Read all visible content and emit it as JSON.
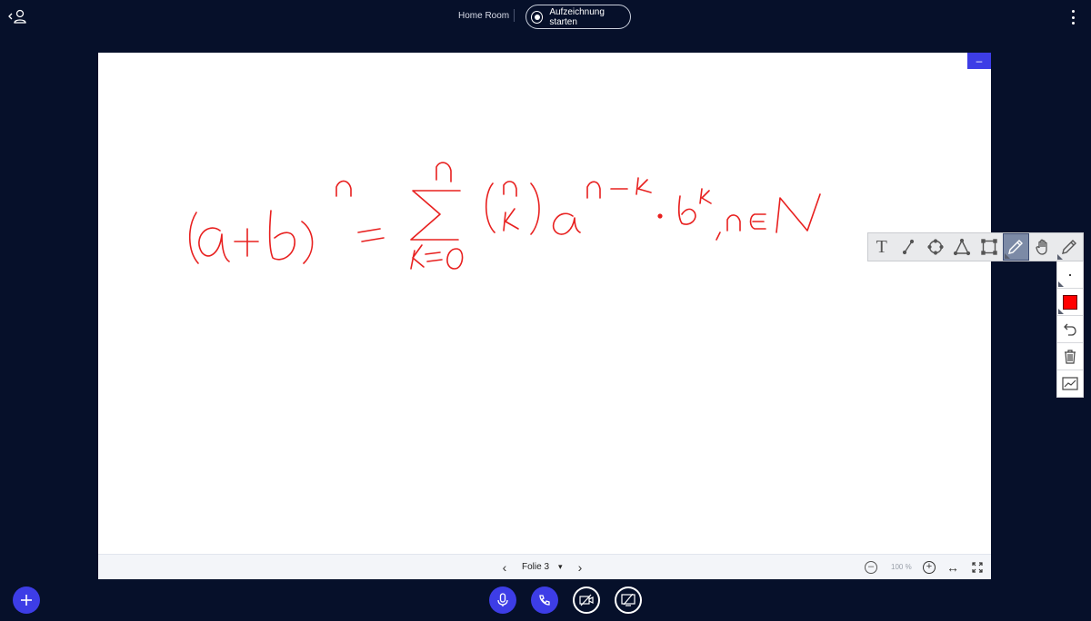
{
  "header": {
    "room_name": "Home Room",
    "record_label": "Aufzeichnung starten"
  },
  "presentation": {
    "minimize_label": "–",
    "slide_label": "Folie 3",
    "zoom_level": "100 %"
  },
  "whiteboard": {
    "tools": [
      {
        "name": "text-tool",
        "icon": "text-icon",
        "glyph": "T"
      },
      {
        "name": "line-tool",
        "icon": "line-icon"
      },
      {
        "name": "ellipse-tool",
        "icon": "ellipse-icon"
      },
      {
        "name": "triangle-tool",
        "icon": "triangle-icon"
      },
      {
        "name": "rectangle-tool",
        "icon": "rectangle-icon"
      },
      {
        "name": "pencil-tool",
        "icon": "pencil-icon",
        "active": true
      },
      {
        "name": "pan-tool",
        "icon": "hand-icon"
      },
      {
        "name": "pen-tool",
        "icon": "pen-icon"
      }
    ],
    "pen_color": "#ff0000",
    "stroke_color": "#e8201f"
  },
  "colors": {
    "background": "#06102a",
    "accent": "#3d3de6"
  }
}
